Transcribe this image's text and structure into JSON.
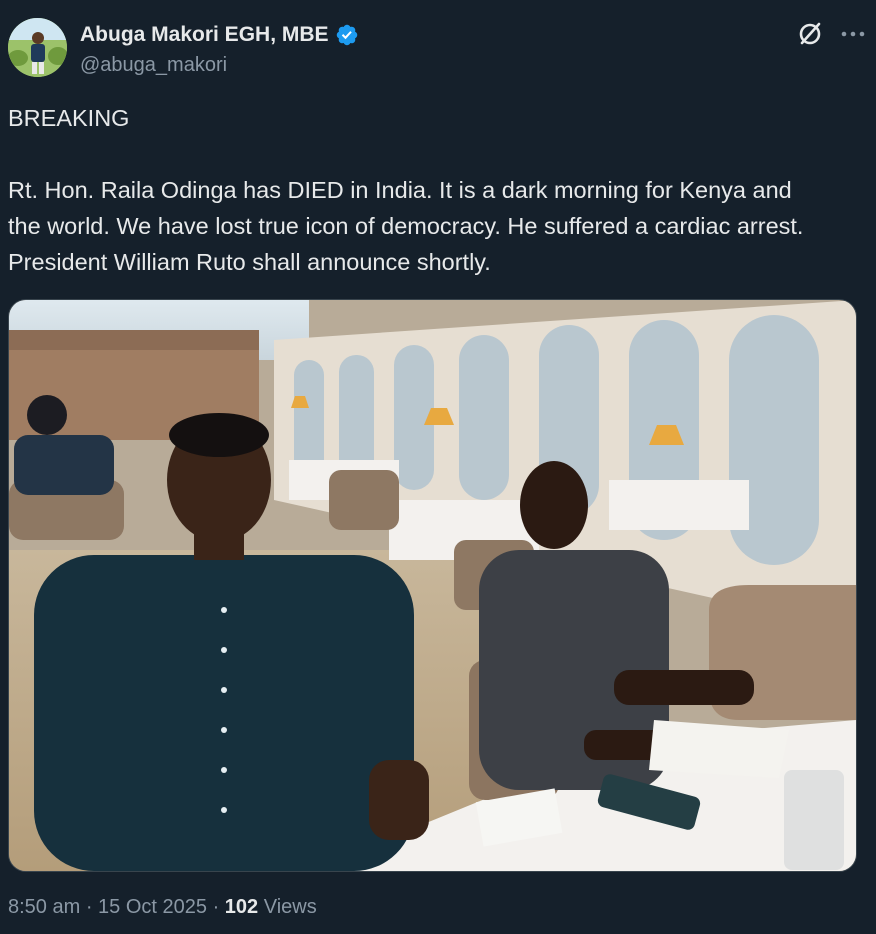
{
  "author": {
    "display_name": "Abuga Makori EGH, MBE",
    "handle": "@abuga_makori",
    "verified": true,
    "avatar_icon": "profile-avatar"
  },
  "tweet": {
    "text": "BREAKING\n\nRt. Hon. Raila Odinga has DIED in India. It is a dark morning for Kenya and the world. We have lost true icon of democracy. He suffered a cardiac arrest. President William Ruto shall announce shortly.",
    "media_description_icon": "photo"
  },
  "meta": {
    "time": "8:50 am",
    "separator": " · ",
    "date": "15 Oct 2025",
    "views_count": "102",
    "views_label": "Views"
  },
  "icons": {
    "grok": "grok-icon",
    "more": "more-icon",
    "verified": "verified-badge-icon"
  },
  "colors": {
    "background": "#15202b",
    "text": "#e7e9ea",
    "muted": "#8b98a5",
    "verified": "#1d9bf0"
  }
}
